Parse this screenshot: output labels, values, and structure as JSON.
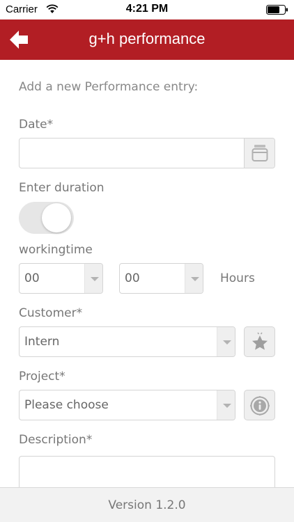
{
  "status_bar": {
    "carrier": "Carrier",
    "time": "4:21 PM",
    "wifi_icon": "wifi-icon",
    "battery_icon": "battery-icon"
  },
  "nav": {
    "title": "g+h performance",
    "back_icon": "arrow-left-icon",
    "color": "#b21e24"
  },
  "form": {
    "intro": "Add a new Performance entry:",
    "date_label": "Date*",
    "date_value": "",
    "date_icon": "calendar-icon",
    "duration_label": "Enter duration",
    "duration_toggle_on": false,
    "workingtime_label": "workingtime",
    "hours_value": "00",
    "minutes_value": "00",
    "hours_unit": "Hours",
    "customer_label": "Customer*",
    "customer_value": "Intern",
    "customer_icon": "star-icon",
    "project_label": "Project*",
    "project_value": "Please choose",
    "project_icon": "info-icon",
    "description_label": "Description*",
    "description_value": ""
  },
  "footer": {
    "version": "Version 1.2.0"
  }
}
